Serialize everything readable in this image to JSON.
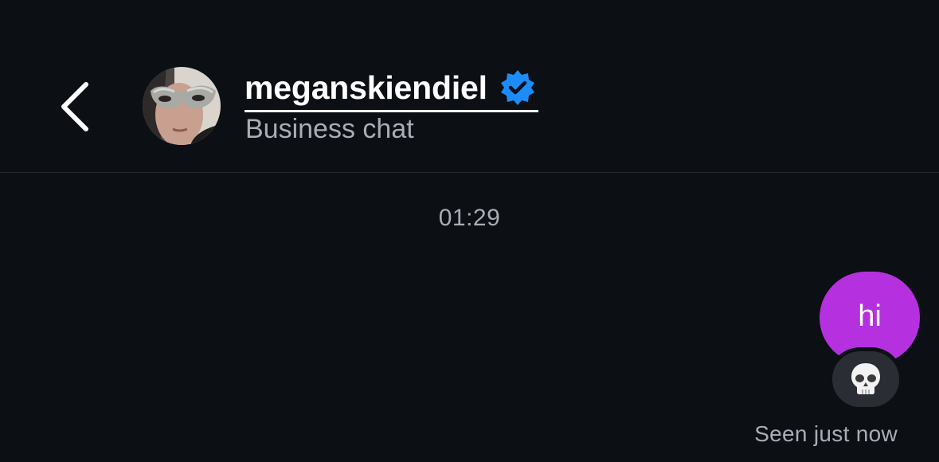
{
  "header": {
    "back_icon": "chevron-left-icon",
    "username": "meganskiendiel",
    "verified_icon": "verified-badge-icon",
    "subtitle": "Business chat"
  },
  "thread": {
    "timestamp": "01:29",
    "messages": [
      {
        "sender": "me",
        "text": "hi",
        "reaction": "skull-emoji-icon"
      }
    ],
    "seen_status": "Seen just now"
  },
  "colors": {
    "background": "#0c0f14",
    "bubble": "#b531e0",
    "verified": "#1d8cf8",
    "secondary_text": "#a8adb6",
    "reaction_pill": "#2a2d33"
  }
}
